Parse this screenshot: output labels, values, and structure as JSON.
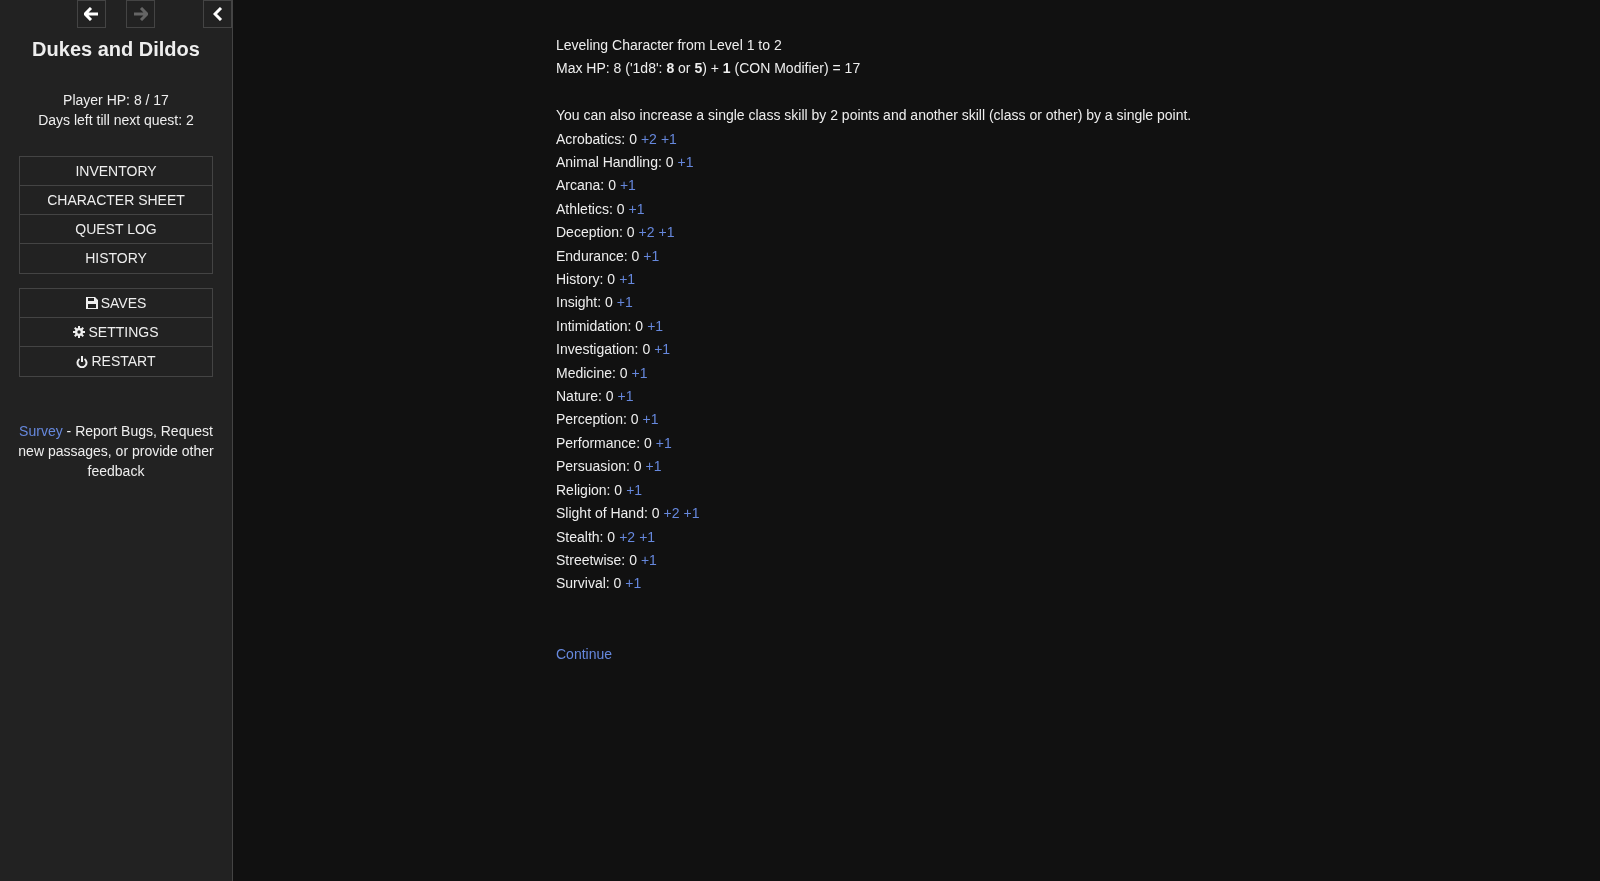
{
  "history_nav": [
    {
      "kind": "back",
      "disabled": false
    },
    {
      "kind": "forward",
      "disabled": true
    }
  ],
  "sidebar_toggle": {
    "kind": "collapse"
  },
  "story_title": "Dukes and Dildos",
  "stats": [
    "Player HP: 8 / 17",
    "Days left till next quest: 2"
  ],
  "menu_groups": [
    {
      "items": [
        {
          "label": "INVENTORY"
        },
        {
          "label": "CHARACTER SHEET"
        },
        {
          "label": "QUEST LOG"
        },
        {
          "label": "HISTORY"
        }
      ]
    },
    {
      "items": [
        {
          "label": "SAVES",
          "kind": "save"
        },
        {
          "label": "SETTINGS",
          "kind": "gear"
        },
        {
          "label": "RESTART",
          "kind": "power"
        }
      ]
    }
  ],
  "survey": {
    "link": "Survey",
    "text": "- Report Bugs, Request new passages, or provide other feedback"
  },
  "passage": {
    "intro": [
      "Leveling Character from Level 1 to 2",
      "Max HP: 8 ('1d8': **8** or **5**) + **1** (CON Modifier) = 17"
    ],
    "instruction": "You can also increase a single class skill by 2 points and another skill (class or other) by a single point.",
    "skills": [
      {
        "text": "Acrobatics: 0",
        "links": [
          "+2",
          "+1"
        ]
      },
      {
        "text": "Animal Handling: 0",
        "links": [
          "+1"
        ]
      },
      {
        "text": "Arcana: 0",
        "links": [
          "+1"
        ]
      },
      {
        "text": "Athletics: 0",
        "links": [
          "+1"
        ]
      },
      {
        "text": "Deception: 0",
        "links": [
          "+2",
          "+1"
        ]
      },
      {
        "text": "Endurance: 0",
        "links": [
          "+1"
        ]
      },
      {
        "text": "History: 0",
        "links": [
          "+1"
        ]
      },
      {
        "text": "Insight: 0",
        "links": [
          "+1"
        ]
      },
      {
        "text": "Intimidation: 0",
        "links": [
          "+1"
        ]
      },
      {
        "text": "Investigation: 0",
        "links": [
          "+1"
        ]
      },
      {
        "text": "Medicine: 0",
        "links": [
          "+1"
        ]
      },
      {
        "text": "Nature: 0",
        "links": [
          "+1"
        ]
      },
      {
        "text": "Perception: 0",
        "links": [
          "+1"
        ]
      },
      {
        "text": "Performance: 0",
        "links": [
          "+1"
        ]
      },
      {
        "text": "Persuasion: 0",
        "links": [
          "+1"
        ]
      },
      {
        "text": "Religion: 0",
        "links": [
          "+1"
        ]
      },
      {
        "text": "Slight of Hand: 0",
        "links": [
          "+2",
          "+1"
        ]
      },
      {
        "text": "Stealth: 0",
        "links": [
          "+2",
          "+1"
        ]
      },
      {
        "text": "Streetwise: 0",
        "links": [
          "+1"
        ]
      },
      {
        "text": "Survival: 0",
        "links": [
          "+1"
        ]
      }
    ],
    "continue": "Continue"
  }
}
